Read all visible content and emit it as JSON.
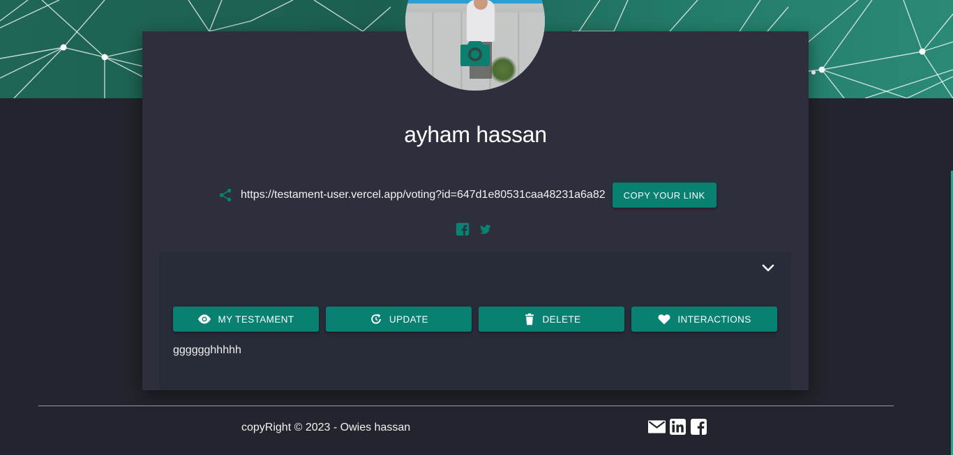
{
  "profile": {
    "name": "ayham hassan",
    "avatar_icon": "camera-icon"
  },
  "share": {
    "icon": "share-icon",
    "link": "https://testament-user.vercel.app/voting?id=647d1e80531caa48231a6a82",
    "copy_label": "COPY YOUR LINK",
    "social": [
      "facebook-icon",
      "twitter-icon"
    ]
  },
  "panel": {
    "collapse_icon": "chevron-down-icon",
    "actions": [
      {
        "label": "MY TESTAMENT",
        "icon": "eye-icon"
      },
      {
        "label": "UPDATE",
        "icon": "refresh-icon"
      },
      {
        "label": "DELETE",
        "icon": "trash-icon"
      },
      {
        "label": "INTERACTIONS",
        "icon": "heart-icon"
      }
    ],
    "testament_text": "gggggghhhhh"
  },
  "footer": {
    "copyright": "copyRight © 2023 - Owies hassan",
    "icons": [
      "mail-icon",
      "linkedin-icon",
      "facebook-icon"
    ]
  },
  "colors": {
    "accent": "#088072",
    "background": "#22252d",
    "card": "#2d303c",
    "panel": "#282b38"
  }
}
